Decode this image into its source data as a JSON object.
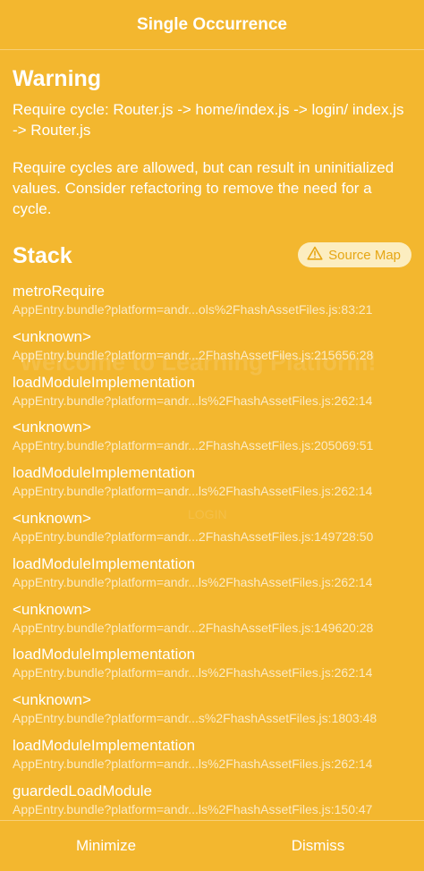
{
  "header": {
    "title": "Single Occurrence"
  },
  "warning": {
    "title": "Warning",
    "message": "Require cycle: Router.js -> home/index.js -> login/ index.js -> Router.js",
    "note": "Require cycles are allowed, but can result in uninitialized values. Consider refactoring to remove the need for a cycle."
  },
  "stack": {
    "title": "Stack",
    "source_map_label": "Source Map",
    "frames": [
      {
        "name": "metroRequire",
        "location": "AppEntry.bundle?platform=andr...ols%2FhashAssetFiles.js:83:21"
      },
      {
        "name": "<unknown>",
        "location": "AppEntry.bundle?platform=andr...2FhashAssetFiles.js:215656:28"
      },
      {
        "name": "loadModuleImplementation",
        "location": "AppEntry.bundle?platform=andr...ls%2FhashAssetFiles.js:262:14"
      },
      {
        "name": "<unknown>",
        "location": "AppEntry.bundle?platform=andr...2FhashAssetFiles.js:205069:51"
      },
      {
        "name": "loadModuleImplementation",
        "location": "AppEntry.bundle?platform=andr...ls%2FhashAssetFiles.js:262:14"
      },
      {
        "name": "<unknown>",
        "location": "AppEntry.bundle?platform=andr...2FhashAssetFiles.js:149728:50"
      },
      {
        "name": "loadModuleImplementation",
        "location": "AppEntry.bundle?platform=andr...ls%2FhashAssetFiles.js:262:14"
      },
      {
        "name": "<unknown>",
        "location": "AppEntry.bundle?platform=andr...2FhashAssetFiles.js:149620:28"
      },
      {
        "name": "loadModuleImplementation",
        "location": "AppEntry.bundle?platform=andr...ls%2FhashAssetFiles.js:262:14"
      },
      {
        "name": "<unknown>",
        "location": "AppEntry.bundle?platform=andr...s%2FhashAssetFiles.js:1803:48"
      },
      {
        "name": "loadModuleImplementation",
        "location": "AppEntry.bundle?platform=andr...ls%2FhashAssetFiles.js:262:14"
      },
      {
        "name": "guardedLoadModule",
        "location": "AppEntry.bundle?platform=andr...ls%2FhashAssetFiles.js:150:47"
      }
    ]
  },
  "background_app": {
    "title": "Welcome to Learning Platform!",
    "login_label": "LOGIN"
  },
  "footer": {
    "minimize_label": "Minimize",
    "dismiss_label": "Dismiss"
  },
  "colors": {
    "background": "#f3b72f",
    "source_map_bg": "#fcedc0",
    "source_map_text": "#e6a614"
  },
  "icons": {
    "source_map": "warning-triangle-icon"
  }
}
